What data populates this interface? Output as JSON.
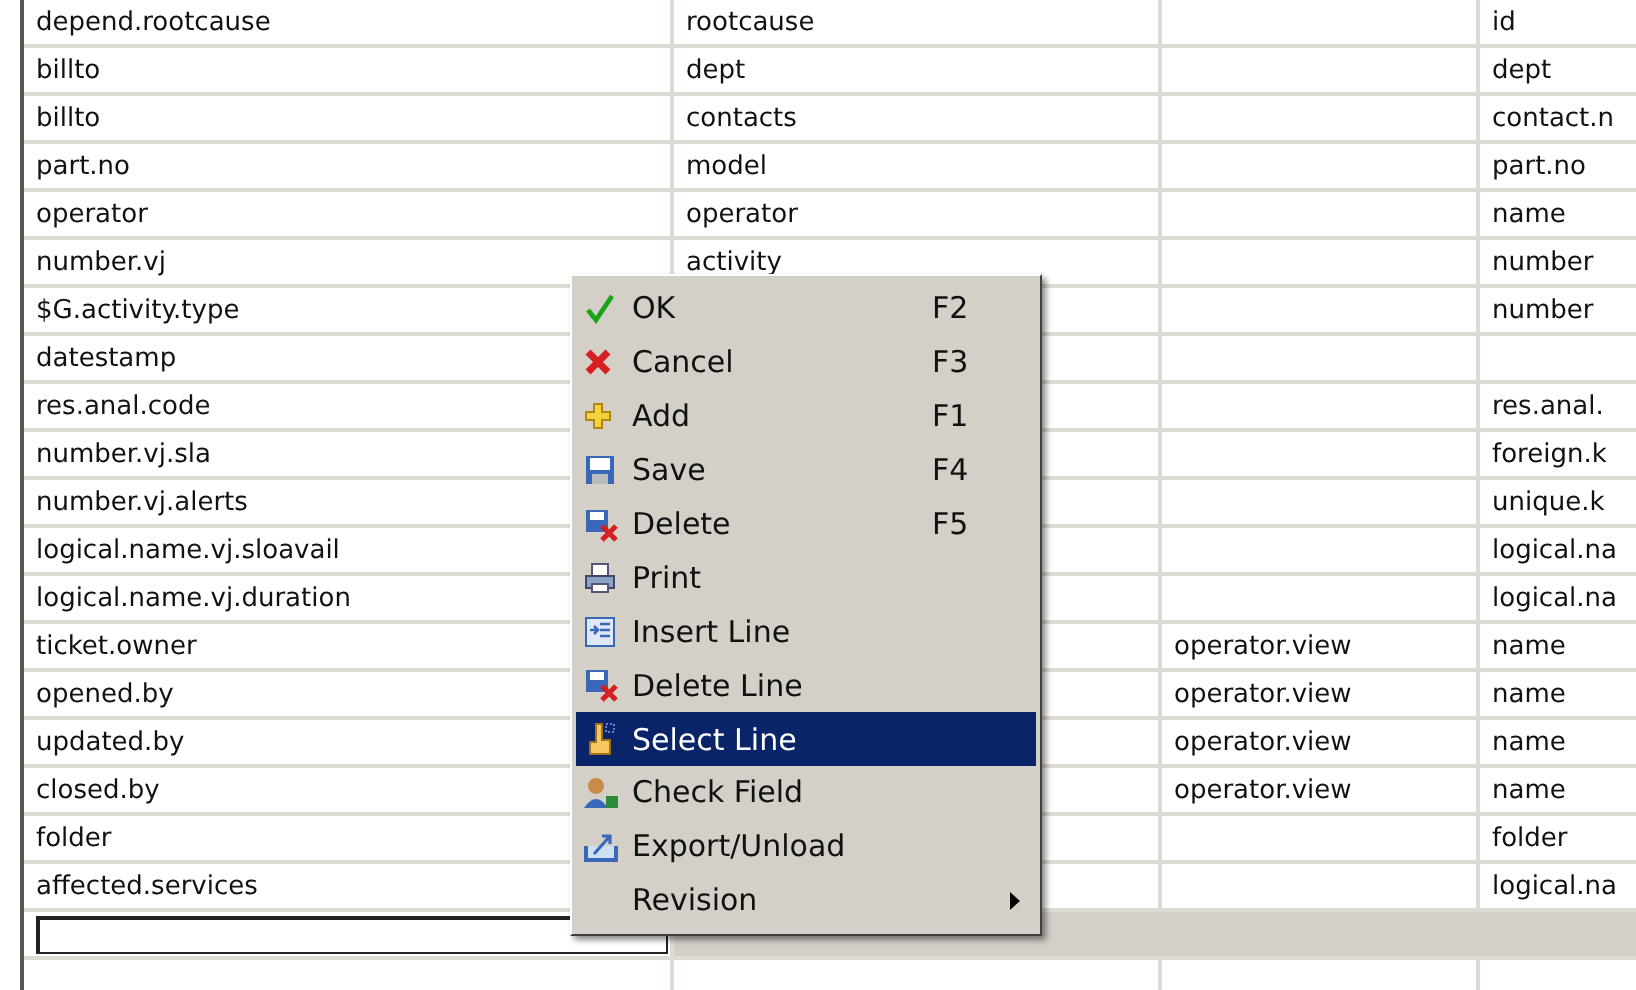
{
  "table": {
    "rows": [
      {
        "column_1": "depend.rootcause",
        "column_2": "rootcause",
        "column_4": "id"
      },
      {
        "column_1": "billto",
        "column_2": "dept",
        "column_4": "dept"
      },
      {
        "column_1": "billto",
        "column_2": "contacts",
        "column_4": "contact.n"
      },
      {
        "column_1": "part.no",
        "column_2": "model",
        "column_4": "part.no"
      },
      {
        "column_1": "operator",
        "column_2": "operator",
        "column_4": "name"
      },
      {
        "column_1": "number.vj",
        "column_2": "activity",
        "column_4": "number"
      },
      {
        "column_1": "$G.activity.type",
        "column_4": "number"
      },
      {
        "column_1": "datestamp"
      },
      {
        "column_1": "res.anal.code",
        "column_4": "res.anal."
      },
      {
        "column_1": "number.vj.sla",
        "column_4": "foreign.k"
      },
      {
        "column_1": "number.vj.alerts",
        "column_4": "unique.k"
      },
      {
        "column_1": "logical.name.vj.sloavail",
        "column_4": "logical.na"
      },
      {
        "column_1": "logical.name.vj.duration",
        "column_4": "logical.na"
      },
      {
        "column_1": "ticket.owner",
        "column_3": "operator.view",
        "column_4": "name"
      },
      {
        "column_1": "opened.by",
        "column_3": "operator.view",
        "column_4": "name"
      },
      {
        "column_1": "updated.by",
        "column_3": "operator.view",
        "column_4": "name"
      },
      {
        "column_1": "closed.by",
        "column_3": "operator.view",
        "column_4": "name"
      },
      {
        "column_1": "folder",
        "column_4": "folder"
      },
      {
        "column_1": "affected.services",
        "column_4": "logical.na"
      }
    ]
  },
  "context_menu": {
    "items": [
      {
        "kind": "ok",
        "label": "OK",
        "shortcut": "F2",
        "selected": false
      },
      {
        "kind": "cancel",
        "label": "Cancel",
        "shortcut": "F3",
        "selected": false
      },
      {
        "kind": "add",
        "label": "Add",
        "shortcut": "F1",
        "selected": false
      },
      {
        "kind": "save",
        "label": "Save",
        "shortcut": "F4",
        "selected": false
      },
      {
        "kind": "delete",
        "label": "Delete",
        "shortcut": "F5",
        "selected": false
      },
      {
        "kind": "print",
        "label": "Print",
        "selected": false
      },
      {
        "kind": "insert",
        "label": "Insert Line",
        "selected": false
      },
      {
        "kind": "delete",
        "label": "Delete Line",
        "selected": false
      },
      {
        "kind": "select",
        "label": "Select Line",
        "selected": true
      },
      {
        "kind": "check",
        "label": "Check Field",
        "selected": false
      },
      {
        "kind": "export",
        "label": "Export/Unload",
        "selected": false
      },
      {
        "kind": "submenu",
        "label": "Revision",
        "selected": false
      }
    ]
  }
}
